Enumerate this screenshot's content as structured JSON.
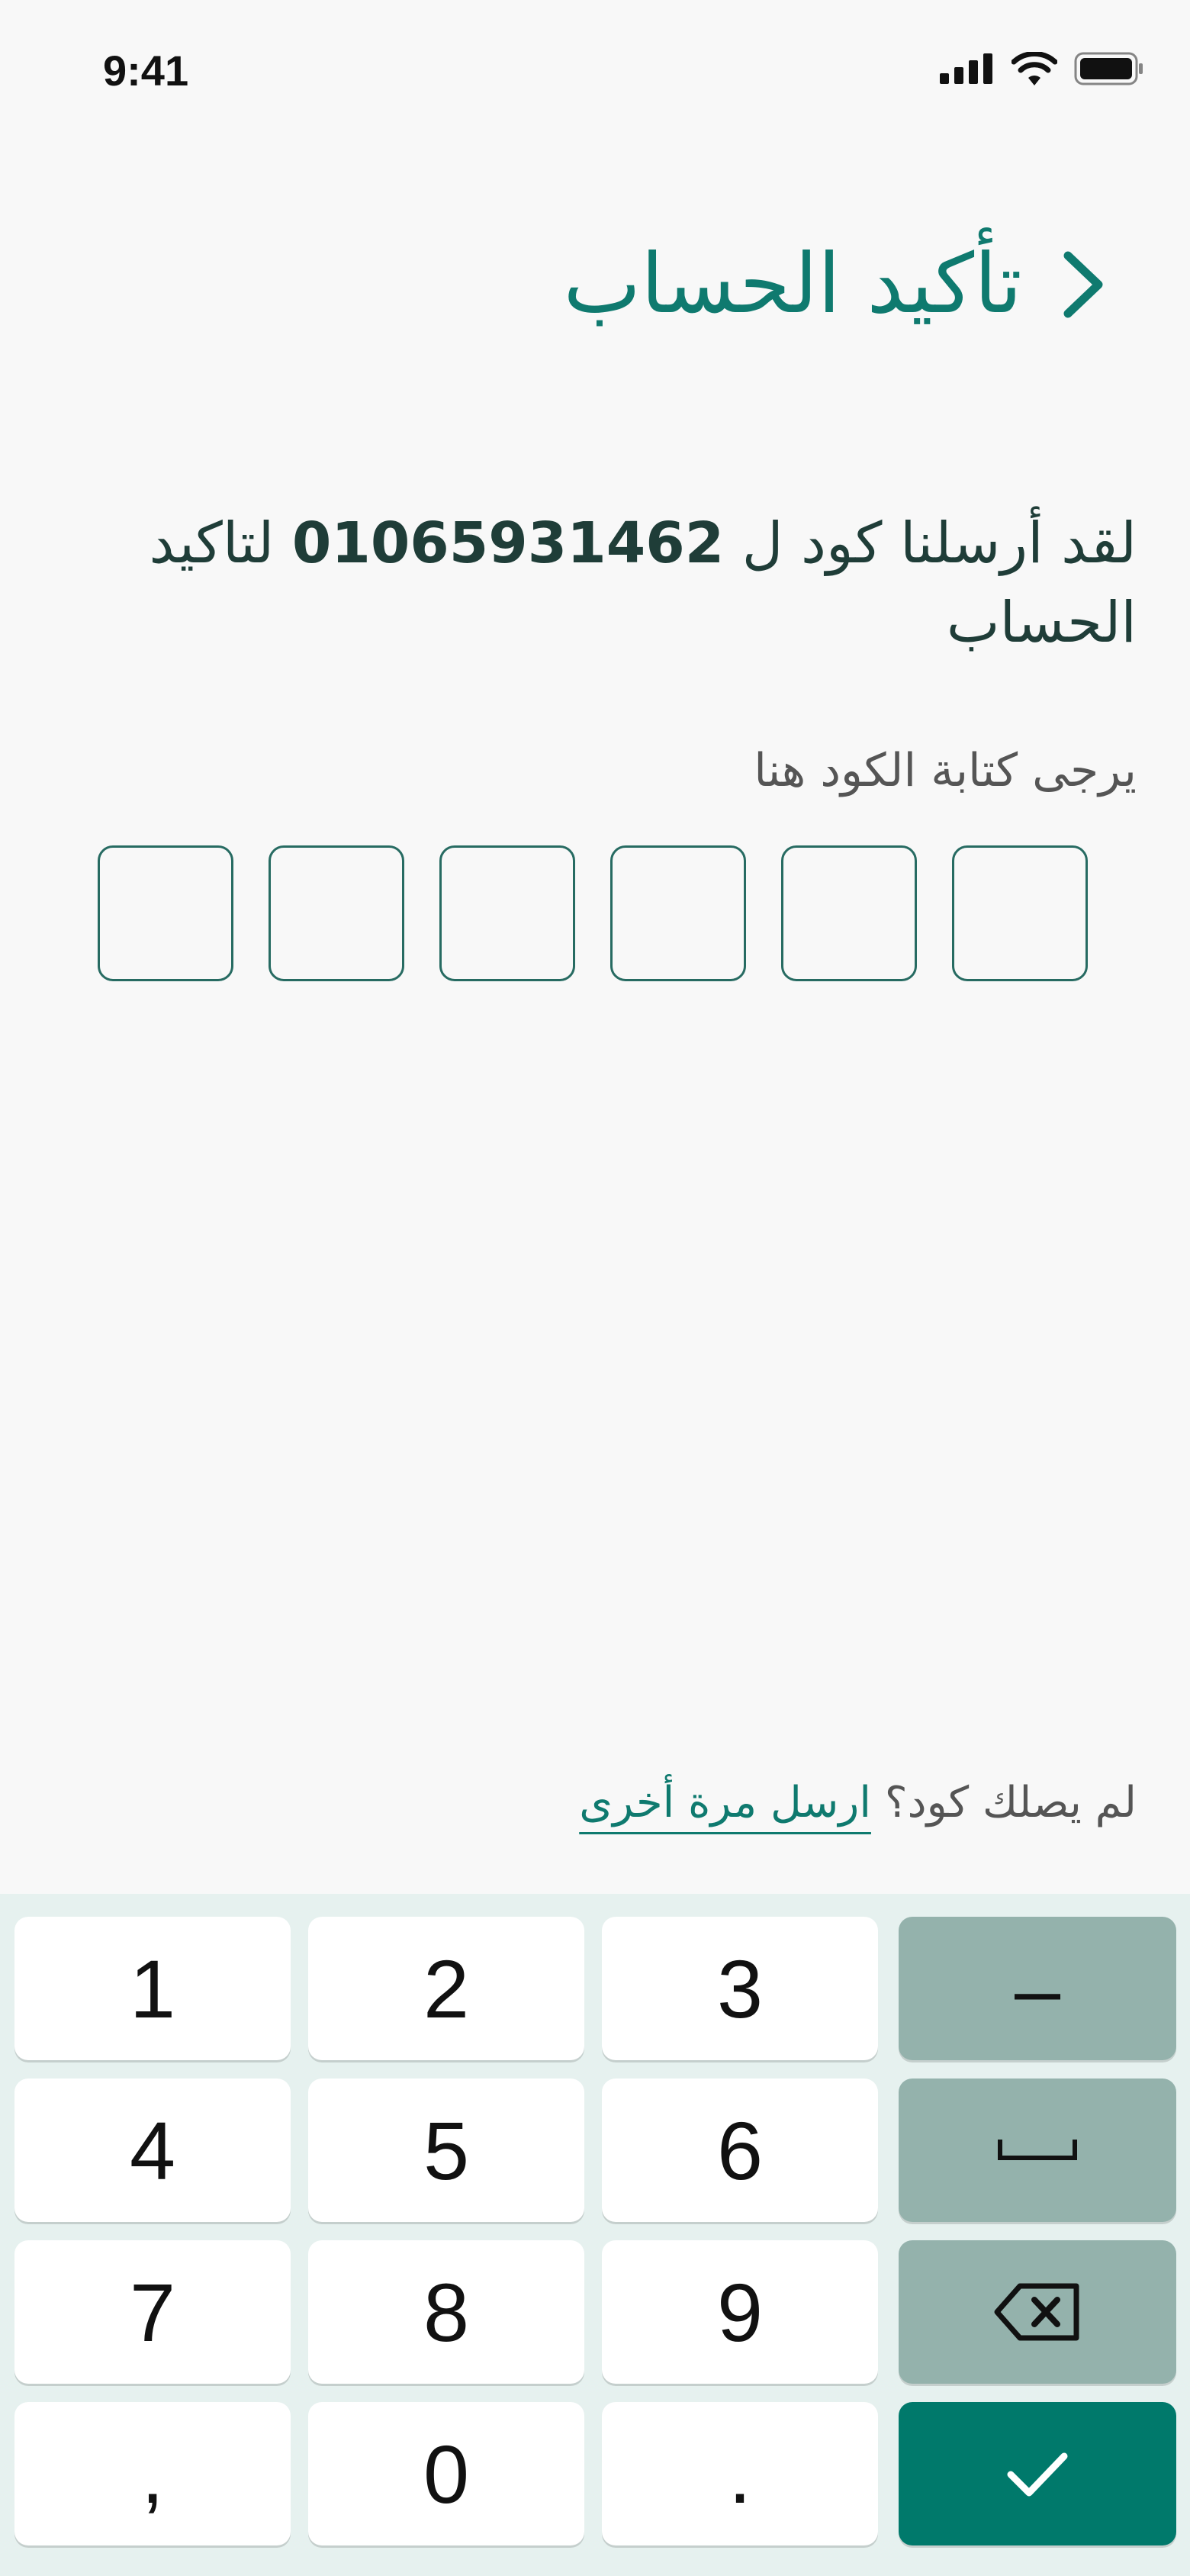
{
  "status_bar": {
    "time": "9:41",
    "icons": [
      "signal-icon",
      "wifi-icon",
      "battery-icon"
    ]
  },
  "header": {
    "title": "تأكيد الحساب",
    "back_icon": "chevron-right-icon"
  },
  "message": {
    "before": "لقد أرسلنا كود ل ",
    "phone": "01065931462",
    "after": " لتاكيد الحساب"
  },
  "hint": "يرجى كتابة الكود هنا",
  "otp": {
    "length": 6,
    "values": [
      "",
      "",
      "",
      "",
      "",
      ""
    ]
  },
  "resend": {
    "question": "لم يصلك كود؟",
    "link": "ارسل مرة أخرى"
  },
  "keyboard": {
    "rows": [
      [
        "1",
        "2",
        "3",
        "-"
      ],
      [
        "4",
        "5",
        "6",
        "space"
      ],
      [
        "7",
        "8",
        "9",
        "backspace"
      ],
      [
        ",",
        "0",
        ".",
        "done"
      ]
    ],
    "labels": {
      "k1": "1",
      "k2": "2",
      "k3": "3",
      "minus": "–",
      "k4": "4",
      "k5": "5",
      "k6": "6",
      "k7": "7",
      "k8": "8",
      "k9": "9",
      "comma": ",",
      "k0": "0",
      "dot": "."
    },
    "icons": {
      "space": "space-icon",
      "backspace": "backspace-icon",
      "done": "checkmark-icon"
    }
  },
  "colors": {
    "accent": "#0f7a6f",
    "background": "#f8f8f8",
    "keyboard_bg": "#e6f1ef",
    "action_key": "#94b2ac",
    "done_key": "#00796b"
  }
}
